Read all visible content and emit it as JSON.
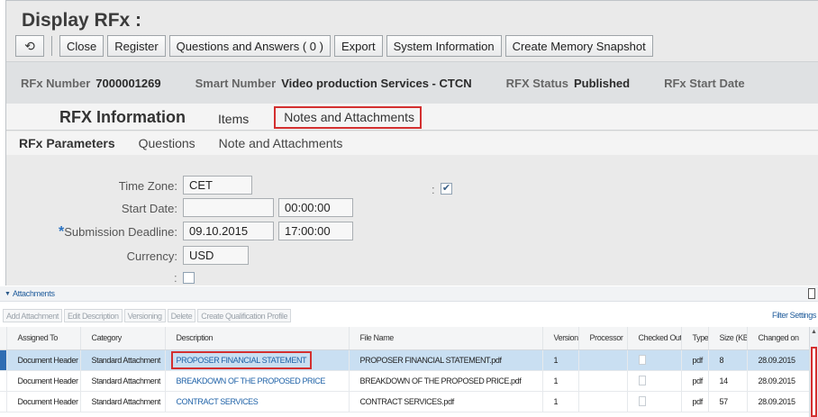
{
  "page": {
    "title": "Display RFx :"
  },
  "toolbar": {
    "refresh_icon": "⟲",
    "buttons": [
      "Close",
      "Register",
      "Questions and Answers ( 0 )",
      "Export",
      "System Information",
      "Create Memory Snapshot"
    ]
  },
  "header": {
    "rfx_number_label": "RFx Number",
    "rfx_number": "7000001269",
    "smart_number_label": "Smart Number",
    "smart_number": "Video production Services - CTCN",
    "status_label": "RFX Status",
    "status": "Published",
    "start_date_label": "RFx Start Date"
  },
  "main_tabs": [
    "RFX Information",
    "Items",
    "Notes and Attachments"
  ],
  "sub_tabs": [
    "RFx Parameters",
    "Questions",
    "Note and Attachments"
  ],
  "form": {
    "time_zone_label": "Time Zone:",
    "time_zone": "CET",
    "start_date_label": "Start Date:",
    "start_date": "",
    "start_time": "00:00:00",
    "submission_label": "Submission Deadline:",
    "submission_date": "09.10.2015",
    "submission_time": "17:00:00",
    "currency_label": "Currency:",
    "currency": "USD",
    "check_colon": ":",
    "checkmark": "✔",
    "required_marker": "*"
  },
  "attachments": {
    "title": "Attachments",
    "toolbar": [
      "Add Attachment",
      "Edit Description",
      "Versioning",
      "Delete",
      "Create Qualification Profile"
    ],
    "filter_link": "Filter Settings",
    "columns": [
      "Assigned To",
      "Category",
      "Description",
      "File Name",
      "Version",
      "Processor",
      "Checked Out",
      "Type",
      "Size (KB)",
      "Changed on"
    ],
    "rows": [
      {
        "assigned": "Document Header",
        "category": "Standard Attachment",
        "description": "PROPOSER FINANCIAL STATEMENT",
        "file": "PROPOSER FINANCIAL STATEMENT.pdf",
        "version": "1",
        "processor": "",
        "type": "pdf",
        "size": "8",
        "changed": "28.09.2015"
      },
      {
        "assigned": "Document Header",
        "category": "Standard Attachment",
        "description": "BREAKDOWN OF THE PROPOSED PRICE",
        "file": "BREAKDOWN OF THE PROPOSED PRICE.pdf",
        "version": "1",
        "processor": "",
        "type": "pdf",
        "size": "14",
        "changed": "28.09.2015"
      },
      {
        "assigned": "Document Header",
        "category": "Standard Attachment",
        "description": "CONTRACT SERVICES",
        "file": "CONTRACT SERVICES.pdf",
        "version": "1",
        "processor": "",
        "type": "pdf",
        "size": "57",
        "changed": "28.09.2015"
      }
    ]
  },
  "colors": {
    "highlight_red": "#d32f2f",
    "link_blue": "#2063a8",
    "selected_row": "#c9dff2",
    "required_blue": "#2b73c1"
  }
}
